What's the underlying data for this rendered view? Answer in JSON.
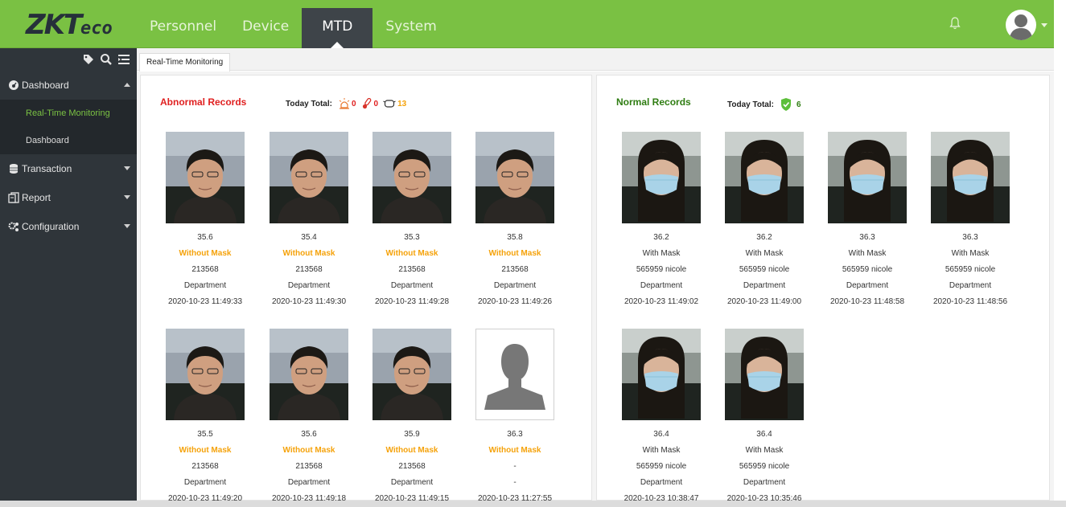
{
  "brand": {
    "logo_text": "ZKTeco",
    "accent": "#7ac143",
    "sidebar_bg": "#2f353a"
  },
  "nav": {
    "items": [
      "Personnel",
      "Device",
      "MTD",
      "System"
    ],
    "active": "MTD"
  },
  "header_icons": [
    "bell-icon",
    "avatar-icon",
    "chevron-down-icon"
  ],
  "sidebar": {
    "tool_icons": [
      "tag-icon",
      "search-icon",
      "list-icon"
    ],
    "items": [
      {
        "label": "Dashboard",
        "icon": "dashboard-icon",
        "expanded": true,
        "children": [
          "Real-Time Monitoring",
          "Dashboard"
        ]
      },
      {
        "label": "Transaction",
        "icon": "database-icon"
      },
      {
        "label": "Report",
        "icon": "report-icon"
      },
      {
        "label": "Configuration",
        "icon": "gears-icon"
      }
    ],
    "active_child": "Real-Time Monitoring"
  },
  "tab": {
    "label": "Real-Time Monitoring"
  },
  "abnormal": {
    "title": "Abnormal Records",
    "total_label": "Today Total:",
    "counts": {
      "alarm": "0",
      "thermometer": "0",
      "mask": "13"
    },
    "records": [
      {
        "temp": "35.6",
        "mask": "Without Mask",
        "id": "213568",
        "dept": "Department",
        "time": "2020-10-23 11:49:33",
        "photo": "face"
      },
      {
        "temp": "35.4",
        "mask": "Without Mask",
        "id": "213568",
        "dept": "Department",
        "time": "2020-10-23 11:49:30",
        "photo": "face"
      },
      {
        "temp": "35.3",
        "mask": "Without Mask",
        "id": "213568",
        "dept": "Department",
        "time": "2020-10-23 11:49:28",
        "photo": "face"
      },
      {
        "temp": "35.8",
        "mask": "Without Mask",
        "id": "213568",
        "dept": "Department",
        "time": "2020-10-23 11:49:26",
        "photo": "face"
      },
      {
        "temp": "35.5",
        "mask": "Without Mask",
        "id": "213568",
        "dept": "Department",
        "time": "2020-10-23 11:49:20",
        "photo": "face"
      },
      {
        "temp": "35.6",
        "mask": "Without Mask",
        "id": "213568",
        "dept": "Department",
        "time": "2020-10-23 11:49:18",
        "photo": "face"
      },
      {
        "temp": "35.9",
        "mask": "Without Mask",
        "id": "213568",
        "dept": "Department",
        "time": "2020-10-23 11:49:15",
        "photo": "face"
      },
      {
        "temp": "36.3",
        "mask": "Without Mask",
        "id": "-",
        "dept": "-",
        "time": "2020-10-23 11:27:55",
        "photo": "silhouette"
      }
    ]
  },
  "normal": {
    "title": "Normal Records",
    "total_label": "Today Total:",
    "count": "6",
    "records": [
      {
        "temp": "36.2",
        "mask": "With Mask",
        "id": "565959 nicole",
        "dept": "Department",
        "time": "2020-10-23 11:49:02",
        "photo": "masked"
      },
      {
        "temp": "36.2",
        "mask": "With Mask",
        "id": "565959 nicole",
        "dept": "Department",
        "time": "2020-10-23 11:49:00",
        "photo": "masked"
      },
      {
        "temp": "36.3",
        "mask": "With Mask",
        "id": "565959 nicole",
        "dept": "Department",
        "time": "2020-10-23 11:48:58",
        "photo": "masked"
      },
      {
        "temp": "36.3",
        "mask": "With Mask",
        "id": "565959 nicole",
        "dept": "Department",
        "time": "2020-10-23 11:48:56",
        "photo": "masked"
      },
      {
        "temp": "36.4",
        "mask": "With Mask",
        "id": "565959 nicole",
        "dept": "Department",
        "time": "2020-10-23 10:38:47",
        "photo": "masked"
      },
      {
        "temp": "36.4",
        "mask": "With Mask",
        "id": "565959 nicole",
        "dept": "Department",
        "time": "2020-10-23 10:35:46",
        "photo": "masked"
      }
    ]
  }
}
